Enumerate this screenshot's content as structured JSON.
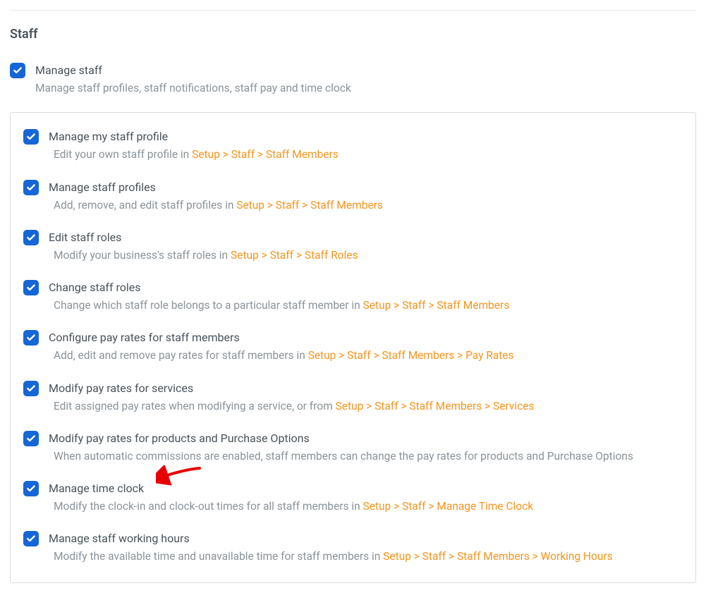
{
  "section_title": "Staff",
  "main_permission": {
    "label": "Manage staff",
    "description": "Manage staff profiles, staff notifications, staff pay and time clock"
  },
  "sub_permissions": [
    {
      "label": "Manage my staff profile",
      "description_prefix": "Edit your own staff profile in ",
      "link": "Setup > Staff > Staff Members",
      "description_suffix": ""
    },
    {
      "label": "Manage staff profiles",
      "description_prefix": "Add, remove, and edit staff profiles in ",
      "link": "Setup > Staff > Staff Members",
      "description_suffix": ""
    },
    {
      "label": "Edit staff roles",
      "description_prefix": "Modify your business's staff roles in ",
      "link": "Setup > Staff > Staff Roles",
      "description_suffix": ""
    },
    {
      "label": "Change staff roles",
      "description_prefix": "Change which staff role belongs to a particular staff member in ",
      "link": "Setup > Staff > Staff Members",
      "description_suffix": ""
    },
    {
      "label": "Configure pay rates for staff members",
      "description_prefix": "Add, edit and remove pay rates for staff members in ",
      "link": "Setup > Staff > Staff Members > Pay Rates",
      "description_suffix": ""
    },
    {
      "label": "Modify pay rates for services",
      "description_prefix": "Edit assigned pay rates when modifying a service, or from ",
      "link": "Setup > Staff > Staff Members > Services",
      "description_suffix": ""
    },
    {
      "label": "Modify pay rates for products and Purchase Options",
      "description_prefix": "When automatic commissions are enabled, staff members can change the pay rates for products and Purchase Options",
      "link": "",
      "description_suffix": ""
    },
    {
      "label": "Manage time clock",
      "description_prefix": "Modify the clock-in and clock-out times for all staff members in ",
      "link": "Setup > Staff > Manage Time Clock",
      "description_suffix": ""
    },
    {
      "label": "Manage staff working hours",
      "description_prefix": "Modify the available time and unavailable time for staff members in ",
      "link": "Setup > Staff > Staff Members > Working Hours",
      "description_suffix": ""
    }
  ]
}
